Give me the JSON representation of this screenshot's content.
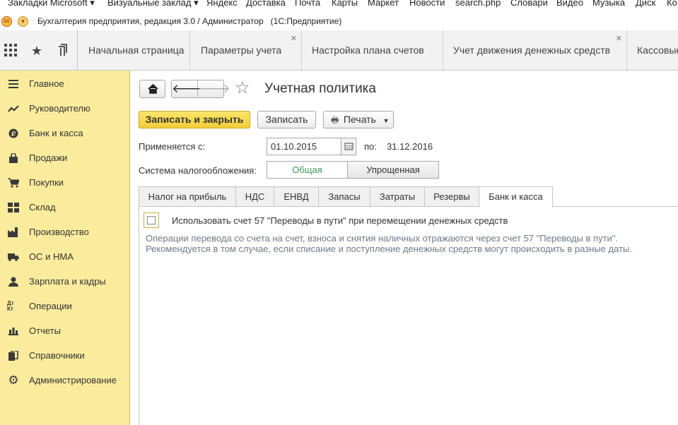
{
  "browser": {
    "bookmarks": [
      {
        "label": "Закладки Microsoft",
        "has_dropdown": true
      },
      {
        "label": "Визуальные заклад",
        "has_dropdown": true
      },
      {
        "label": "Яндекс"
      },
      {
        "label": "Доставка"
      },
      {
        "label": "Почта"
      },
      {
        "label": "Карты"
      },
      {
        "label": "Маркет"
      },
      {
        "label": "Новости"
      },
      {
        "label": "search.php"
      },
      {
        "label": "Словари"
      },
      {
        "label": "Видео"
      },
      {
        "label": "Музыка"
      },
      {
        "label": "Диск"
      },
      {
        "label": "Ко"
      }
    ]
  },
  "app": {
    "logo_text": "1С",
    "title": "Бухгалтерия предприятия, редакция 3.0 / Администратор",
    "platform": "(1С:Предприятие)"
  },
  "sections_bar": {
    "icons": [
      "apps-grid-icon",
      "favorites-star-icon",
      "history-icon"
    ],
    "open_tabs": [
      {
        "label": "Начальная страница",
        "closable": false
      },
      {
        "label": "Параметры учета",
        "closable": true
      },
      {
        "label": "Настройка плана счетов",
        "closable": false
      },
      {
        "label": "Учет движения денежных средств",
        "closable": true
      },
      {
        "label": "Кассовые",
        "closable": false
      }
    ]
  },
  "sidebar": {
    "items": [
      {
        "label": "Главное",
        "icon": "menu-lines-icon"
      },
      {
        "label": "Руководителю",
        "icon": "trend-chart-icon"
      },
      {
        "label": "Банк и касса",
        "icon": "ruble-coin-icon"
      },
      {
        "label": "Продажи",
        "icon": "shopping-bag-icon"
      },
      {
        "label": "Покупки",
        "icon": "cart-icon"
      },
      {
        "label": "Склад",
        "icon": "warehouse-icon"
      },
      {
        "label": "Производство",
        "icon": "factory-icon"
      },
      {
        "label": "ОС и НМА",
        "icon": "truck-icon"
      },
      {
        "label": "Зарплата и кадры",
        "icon": "person-icon"
      },
      {
        "label": "Операции",
        "icon": "dt-kt-icon"
      },
      {
        "label": "Отчеты",
        "icon": "bar-chart-icon"
      },
      {
        "label": "Справочники",
        "icon": "books-icon"
      },
      {
        "label": "Администрирование",
        "icon": "gear-icon"
      }
    ],
    "dt_kt_text": "Дт Кт"
  },
  "form": {
    "title": "Учетная политика",
    "save_close_label": "Записать и закрыть",
    "save_label": "Записать",
    "print_label": "Печать",
    "applies_from_label": "Применяется с:",
    "applies_from_value": "01.10.2015",
    "to_label": "по:",
    "to_value": "31.12.2016",
    "tax_system_label": "Система налогообложения:",
    "tax_options": [
      "Общая",
      "Упрощенная"
    ],
    "tax_selected": "Общая",
    "tabs": [
      "Налог на прибыль",
      "НДС",
      "ЕНВД",
      "Запасы",
      "Затраты",
      "Резервы",
      "Банк и касса"
    ],
    "active_tab": "Банк и касса",
    "checkbox_label": "Использовать счет 57 \"Переводы в пути\" при перемещении денежных средств",
    "checkbox_checked": false,
    "hint_line1": "Операции перевода со счета на счет, взноса и снятия наличных отражаются через счет 57 \"Переводы в пути\".",
    "hint_line2": "Рекомендуется в том случае, если списание и поступление денежных средств могут происходить в разные даты."
  },
  "colors": {
    "sidebar_bg": "#fbec9d",
    "primary_button": "#f3cd3a",
    "selected_option_text": "#3f9a5a",
    "hint_text": "#6c7b86"
  }
}
